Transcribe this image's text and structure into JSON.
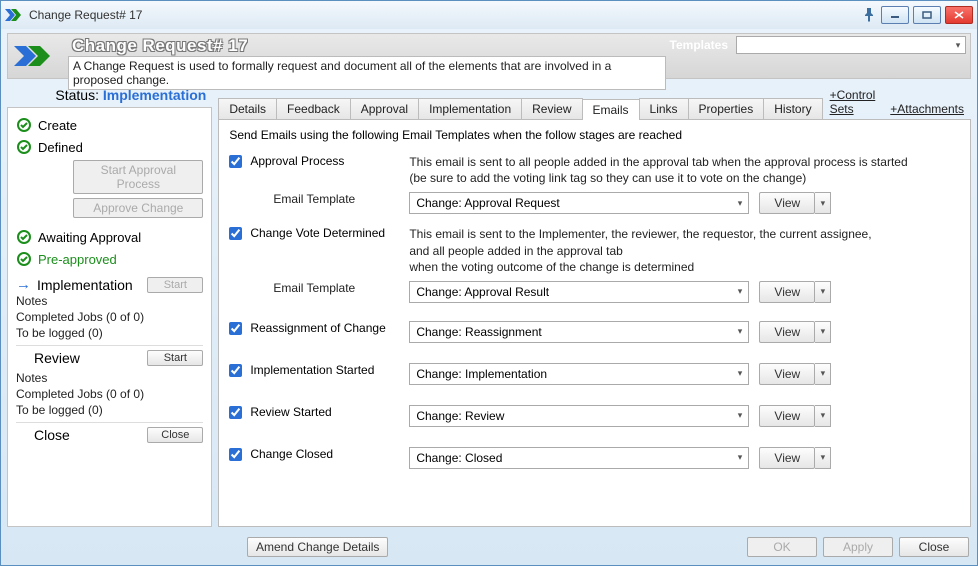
{
  "window": {
    "title": "Change Request# 17"
  },
  "header": {
    "big_title": "Change Request# 17",
    "description": "A Change Request is used to formally request and document all of the elements that are involved in a proposed change.",
    "templates_label": "Templates"
  },
  "status": {
    "label": "Status:",
    "value": "Implementation",
    "stages": {
      "create": "Create",
      "defined": "Defined",
      "awaiting": "Awaiting Approval",
      "preapproved": "Pre-approved",
      "implementation": "Implementation",
      "review": "Review",
      "close": "Close"
    },
    "buttons": {
      "start_approval": "Start Approval Process",
      "approve_change": "Approve Change",
      "start_impl": "Start",
      "review_start": "Start",
      "close": "Close"
    },
    "notes": {
      "label": "Notes",
      "completed_jobs": "Completed Jobs (0 of 0)",
      "to_be_logged": "To be logged (0)"
    }
  },
  "tabs": {
    "details": "Details",
    "feedback": "Feedback",
    "approval": "Approval",
    "implementation": "Implementation",
    "review": "Review",
    "emails": "Emails",
    "links": "Links",
    "properties": "Properties",
    "history": "History",
    "control_sets": "+Control Sets",
    "attachments": "+Attachments"
  },
  "emails": {
    "instruction": "Send Emails using the following Email Templates when the follow stages are reached",
    "email_template_label": "Email Template",
    "view_label": "View",
    "rows": {
      "approval_process": {
        "label": "Approval Process",
        "desc1": "This email is sent to all people added in the approval tab when the approval process is started",
        "desc2": "(be sure to add the voting link tag so they can use it to vote on the change)",
        "template": "Change:  Approval Request"
      },
      "vote_determined": {
        "label": "Change Vote Determined",
        "desc1": "This email is sent to the Implementer, the reviewer, the requestor, the current assignee,",
        "desc2": "and all people added in the approval tab",
        "desc3": "when the voting outcome of the change is determined",
        "template": "Change: Approval Result"
      },
      "reassignment": {
        "label": "Reassignment of  Change",
        "template": "Change: Reassignment"
      },
      "impl_started": {
        "label": "Implementation Started",
        "template": "Change: Implementation"
      },
      "review_started": {
        "label": "Review Started",
        "template": "Change: Review"
      },
      "closed": {
        "label": "Change Closed",
        "template": "Change: Closed"
      }
    }
  },
  "footer": {
    "amend": "Amend Change Details",
    "ok": "OK",
    "apply": "Apply",
    "close": "Close"
  }
}
